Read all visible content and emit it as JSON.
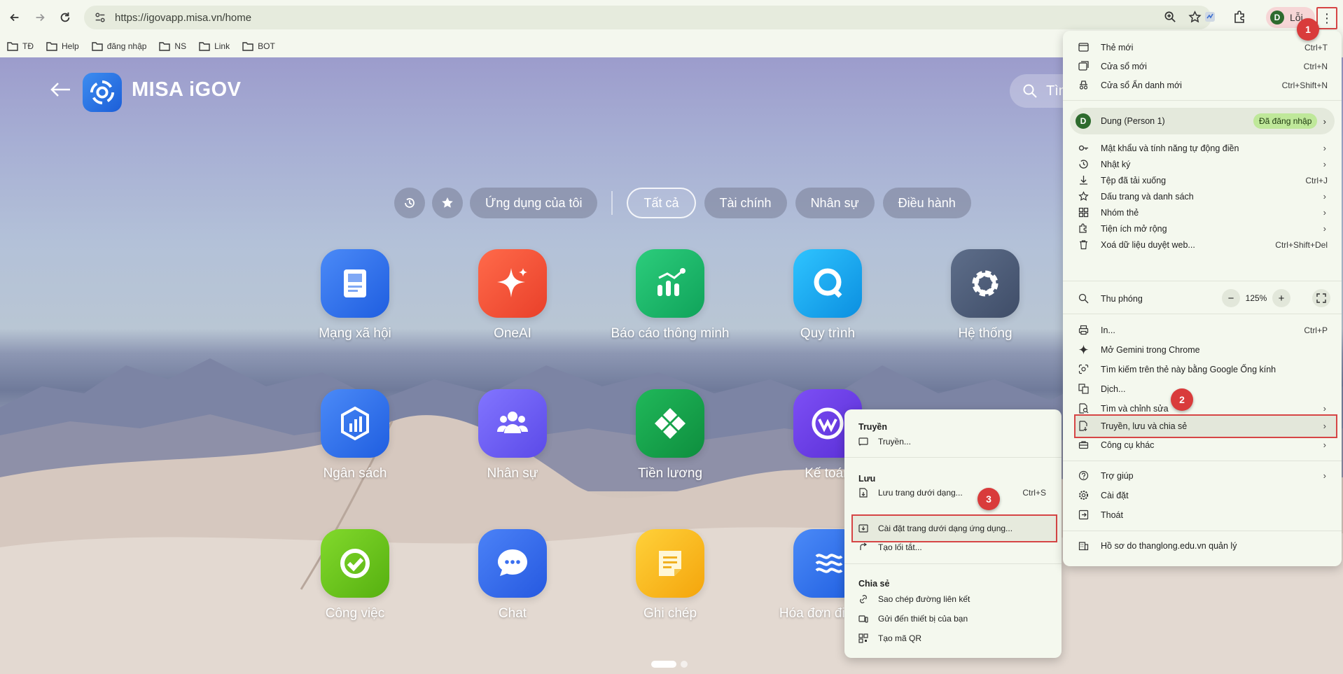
{
  "browser": {
    "url": "https://igovapp.misa.vn/home",
    "profile_label": "Lỗi",
    "profile_initial": "D",
    "bookmarks": [
      "TĐ",
      "Help",
      "đăng nhập",
      "NS",
      "Link",
      "BOT"
    ]
  },
  "page": {
    "brand": "MISA iGOV",
    "search_placeholder": "Tìm",
    "filters": [
      "Ứng dụng của tôi",
      "Tất cả",
      "Tài chính",
      "Nhân sự",
      "Điều hành"
    ],
    "active_filter": "Tất cả",
    "apps": [
      {
        "label": "Mạng xã hội",
        "icon": "newspaper-icon",
        "color": "#2f6fe4"
      },
      {
        "label": "OneAI",
        "icon": "sparkle-icon",
        "color": "#f2533a"
      },
      {
        "label": "Báo cáo thông minh",
        "icon": "report-chart-icon",
        "color": "#1fb86a"
      },
      {
        "label": "Quy trình",
        "icon": "chat-ring-icon",
        "color": "#18a8ef"
      },
      {
        "label": "Hệ thống",
        "icon": "gear-icon",
        "color": "#4d5d78"
      },
      {
        "label": "Ngân sách",
        "icon": "budget-chart-icon",
        "color": "#2f6fe4"
      },
      {
        "label": "Nhân sự",
        "icon": "people-icon",
        "color": "#6d5ff0"
      },
      {
        "label": "Tiền lương",
        "icon": "salary-icon",
        "color": "#16a34a"
      },
      {
        "label": "Kế toán",
        "icon": "accounting-icon",
        "color": "#6d3ee8"
      },
      {
        "label": "Công việc",
        "icon": "check-icon",
        "color": "#6cc31e"
      },
      {
        "label": "Chat",
        "icon": "chat-bubble-icon",
        "color": "#3a6ff0"
      },
      {
        "label": "Ghi chép",
        "icon": "note-icon",
        "color": "#f9b820"
      },
      {
        "label": "Hóa đơn điện tử",
        "icon": "invoice-icon",
        "color": "#2f6fe4"
      }
    ]
  },
  "menu": {
    "items_top": [
      {
        "label": "Thẻ mới",
        "shortcut": "Ctrl+T",
        "icon": "new-tab-icon"
      },
      {
        "label": "Cửa sổ mới",
        "shortcut": "Ctrl+N",
        "icon": "new-window-icon"
      },
      {
        "label": "Cửa sổ Ẩn danh mới",
        "shortcut": "Ctrl+Shift+N",
        "icon": "incognito-icon"
      }
    ],
    "profile_name": "Dung (Person 1)",
    "profile_badge": "Đã đăng nhập",
    "items_mid": [
      {
        "label": "Mật khẩu và tính năng tự động điền",
        "shortcut": "",
        "icon": "key-icon",
        "submenu": true
      },
      {
        "label": "Nhật ký",
        "shortcut": "",
        "icon": "history-icon",
        "submenu": true
      },
      {
        "label": "Tệp đã tải xuống",
        "shortcut": "Ctrl+J",
        "icon": "download-icon",
        "submenu": false
      },
      {
        "label": "Dấu trang và danh sách",
        "shortcut": "",
        "icon": "star-icon",
        "submenu": true
      },
      {
        "label": "Nhóm thẻ",
        "shortcut": "",
        "icon": "tab-groups-icon",
        "submenu": true
      },
      {
        "label": "Tiện ích mở rộng",
        "shortcut": "",
        "icon": "extension-icon",
        "submenu": true
      },
      {
        "label": "Xoá dữ liệu duyệt web...",
        "shortcut": "Ctrl+Shift+Del",
        "icon": "trash-icon",
        "submenu": false
      }
    ],
    "zoom_label": "Thu phóng",
    "zoom_value": "125%",
    "items_tools": [
      {
        "label": "In...",
        "shortcut": "Ctrl+P",
        "icon": "print-icon",
        "submenu": false
      },
      {
        "label": "Mở Gemini trong Chrome",
        "shortcut": "",
        "icon": "gemini-icon",
        "submenu": false
      },
      {
        "label": "Tìm kiếm trên thẻ này bằng Google Ống kính",
        "shortcut": "",
        "icon": "lens-icon",
        "submenu": false
      },
      {
        "label": "Dịch...",
        "shortcut": "",
        "icon": "translate-icon",
        "submenu": false
      },
      {
        "label": "Tìm và chỉnh sửa",
        "shortcut": "",
        "icon": "find-icon",
        "submenu": true
      },
      {
        "label": "Truyền, lưu và chia sẻ",
        "shortcut": "",
        "icon": "cast-save-icon",
        "submenu": true
      },
      {
        "label": "Công cụ khác",
        "shortcut": "",
        "icon": "toolbox-icon",
        "submenu": true
      }
    ],
    "items_bottom": [
      {
        "label": "Trợ giúp",
        "shortcut": "",
        "icon": "help-icon",
        "submenu": true
      },
      {
        "label": "Cài đặt",
        "shortcut": "",
        "icon": "settings-icon",
        "submenu": false
      },
      {
        "label": "Thoát",
        "shortcut": "",
        "icon": "exit-icon",
        "submenu": false
      }
    ],
    "managed_label": "Hồ sơ do thanglong.edu.vn quản lý"
  },
  "submenu": {
    "cast_heading": "Truyền",
    "cast_item": "Truyền...",
    "save_heading": "Lưu",
    "save_page": "Lưu trang dưới dạng...",
    "save_page_shortcut": "Ctrl+S",
    "install_app": "Cài đặt trang dưới dạng ứng dụng...",
    "create_shortcut": "Tạo lối tắt...",
    "share_heading": "Chia sẻ",
    "copy_link": "Sao chép đường liên kết",
    "send_devices": "Gửi đến thiết bị của bạn",
    "qr_code": "Tạo mã QR"
  },
  "steps": [
    "1",
    "2",
    "3"
  ],
  "colors": {
    "accent_red": "#d93b3b",
    "badge_green": "#bfe89a",
    "menu_bg": "#f4f8ee"
  }
}
